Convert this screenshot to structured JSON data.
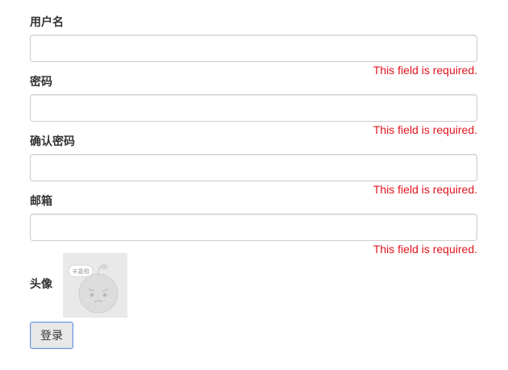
{
  "form": {
    "fields": [
      {
        "label": "用户名",
        "value": "",
        "error": "This field is required."
      },
      {
        "label": "密码",
        "value": "",
        "error": "This field is required."
      },
      {
        "label": "确认密码",
        "value": "",
        "error": "This field is required."
      },
      {
        "label": "邮箱",
        "value": "",
        "error": "This field is required."
      }
    ],
    "avatar": {
      "label": "头像",
      "badge_text": "丰嘉相"
    },
    "submit_label": "登录"
  },
  "colors": {
    "error": "#e0131e",
    "input_border": "#cccccc",
    "button_border": "#6d93d6"
  }
}
